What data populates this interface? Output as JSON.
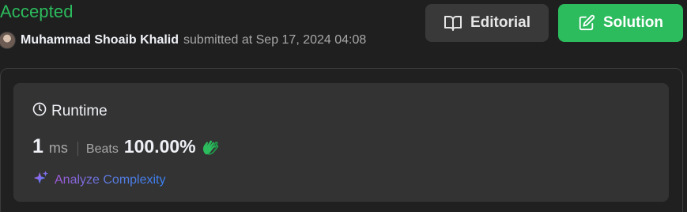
{
  "submission": {
    "status": "Accepted",
    "user_name": "Muhammad Shoaib Khalid",
    "submitted_text": "submitted at Sep 17, 2024 04:08"
  },
  "buttons": {
    "editorial": "Editorial",
    "solution": "Solution"
  },
  "runtime": {
    "title": "Runtime",
    "value": "1",
    "unit": "ms",
    "beats_label": "Beats",
    "beats_value": "100.00%",
    "analyze_label": "Analyze Complexity"
  },
  "colors": {
    "accepted": "#2cbb5d",
    "solution_button": "#2cbb5d",
    "editorial_button": "#393939",
    "card": "#333333",
    "background": "#1f1f1f"
  },
  "icons": {
    "editorial": "book-open-icon",
    "solution": "edit-icon",
    "runtime": "clock-icon",
    "beats": "clapping-hands-icon",
    "analyze": "sparkle-icon"
  }
}
